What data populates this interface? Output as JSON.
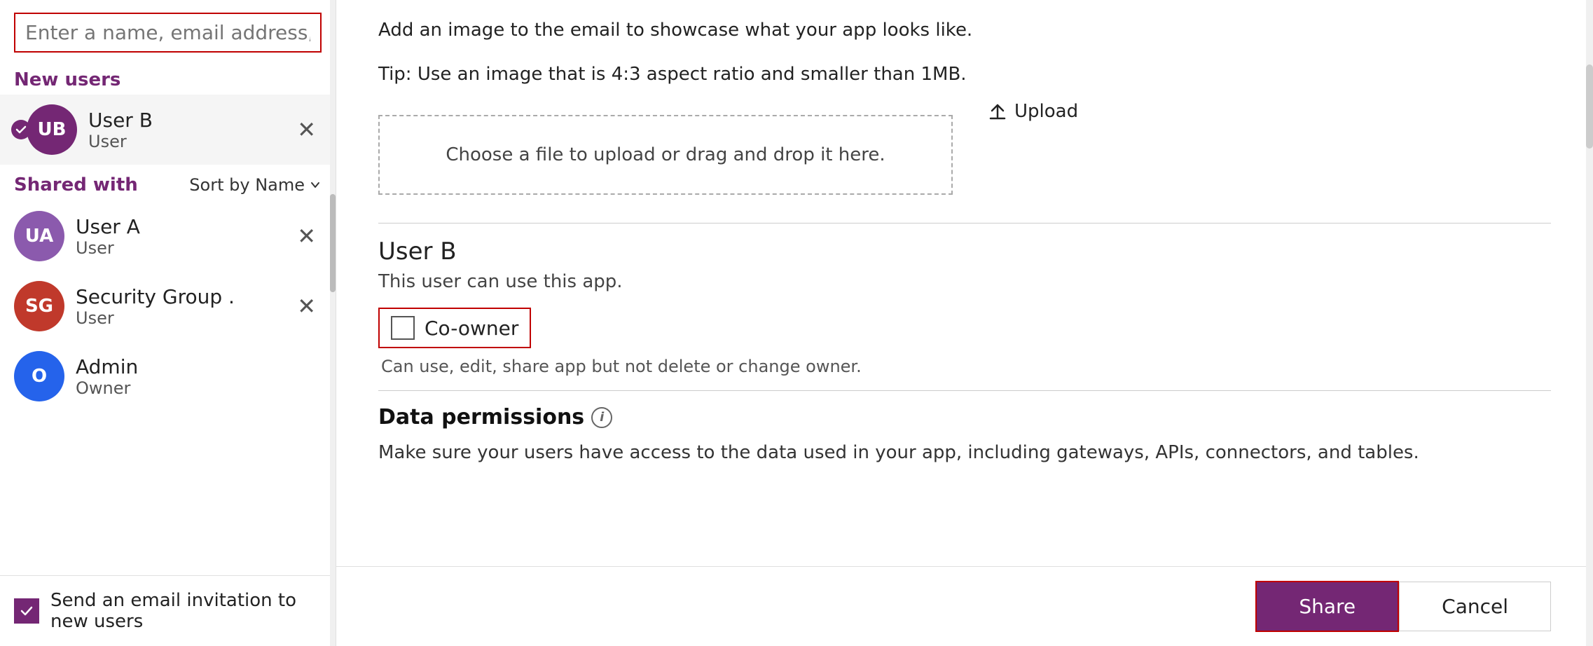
{
  "left": {
    "search_placeholder": "Enter a name, email address, or Everyone",
    "new_users_label": "New users",
    "new_users": [
      {
        "initials": "UB",
        "name": "User B",
        "role": "User",
        "avatar_color": "purple",
        "selected": true
      }
    ],
    "shared_with_label": "Shared with",
    "sort_by_label": "Sort by Name",
    "shared_users": [
      {
        "initials": "UA",
        "name": "User A",
        "role": "User",
        "avatar_color": "light-purple"
      },
      {
        "initials": "SG",
        "name": "Security Group .",
        "role": "User",
        "avatar_color": "red"
      },
      {
        "initials": "O",
        "name": "Admin",
        "role": "Owner",
        "avatar_color": "blue"
      }
    ],
    "send_email_label": "Send an email invitation to new users"
  },
  "right": {
    "tip_line1": "Add an image to the email to showcase what your app looks like.",
    "tip_line2": "Tip: Use an image that is 4:3 aspect ratio and smaller than 1MB.",
    "upload_area_text": "Choose a file to upload or drag and drop it here.",
    "upload_btn_label": "Upload",
    "user_b_title": "User B",
    "user_b_subtitle": "This user can use this app.",
    "coowner_label": "Co-owner",
    "coowner_desc": "Can use, edit, share app but not delete or change owner.",
    "data_permissions_title": "Data permissions",
    "data_permissions_text": "Make sure your users have access to the data used in your app, including gateways, APIs, connectors, and tables.",
    "share_btn_label": "Share",
    "cancel_btn_label": "Cancel"
  }
}
